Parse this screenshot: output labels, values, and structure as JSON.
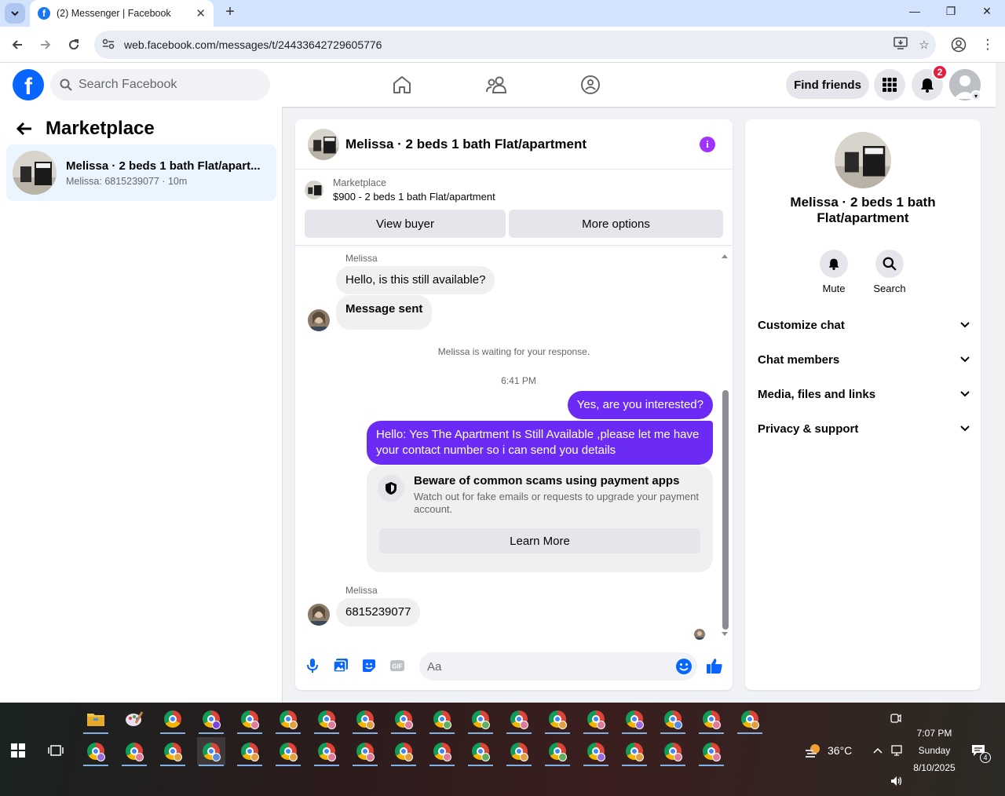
{
  "browser": {
    "tab_title": "(2) Messenger | Facebook",
    "url": "web.facebook.com/messages/t/24433642729605776"
  },
  "fb": {
    "search_placeholder": "Search Facebook",
    "find_friends": "Find friends",
    "notif_count": "2",
    "brand_color": "#0866ff"
  },
  "left": {
    "title": "Marketplace",
    "conv_name": "Melissa · 2 beds 1 bath Flat/apart...",
    "conv_sub": "Melissa: 6815239077 · 10m"
  },
  "chat": {
    "header_title": "Melissa · 2 beds 1 bath Flat/apartment",
    "marketplace_label": "Marketplace",
    "listing": "$900 - 2 beds 1 bath Flat/apartment",
    "view_buyer": "View buyer",
    "more_options": "More options",
    "sender1": "Melissa",
    "msg1": "Hello, is this still available?",
    "msg2": "Message sent",
    "waiting_note": "Melissa is waiting for your response.",
    "timestamp": "6:41 PM",
    "out1": "Yes, are you interested?",
    "out2_line1": "Hello: Yes The Apartment Is Still Available ,please let me have",
    "out2_line2": "your contact number so i can send you details",
    "scam_title": "Beware of common scams using payment apps",
    "scam_body": "Watch out for fake emails or requests to upgrade your payment account.",
    "learn_more": "Learn More",
    "sender2": "Melissa",
    "msg3": "6815239077",
    "composer_placeholder": "Aa",
    "outgoing_color": "#6b2bf5"
  },
  "right": {
    "name": "Melissa · 2 beds 1 bath Flat/apartment",
    "mute": "Mute",
    "search": "Search",
    "sections": [
      "Customize chat",
      "Chat members",
      "Media, files and links",
      "Privacy & support"
    ]
  },
  "taskbar": {
    "temperature": "36°C",
    "time": "7:07 PM",
    "day": "Sunday",
    "date": "8/10/2025",
    "notif_count": "4"
  }
}
